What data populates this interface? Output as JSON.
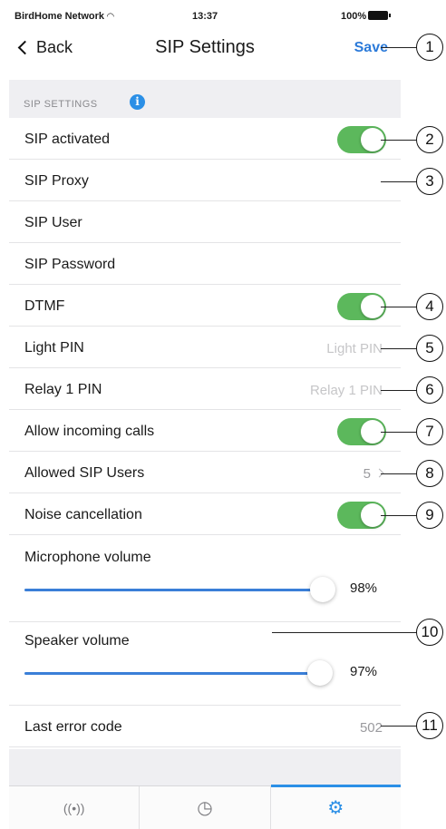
{
  "status_bar": {
    "carrier": "BirdHome Network",
    "time": "13:37",
    "battery": "100%"
  },
  "nav": {
    "back_label": "Back",
    "title": "SIP Settings",
    "save_label": "Save"
  },
  "section": {
    "title": "SIP SETTINGS",
    "info_glyph": "i"
  },
  "rows": [
    {
      "label": "SIP activated",
      "kind": "toggle",
      "on": true
    },
    {
      "label": "SIP Proxy",
      "kind": "text",
      "value": ""
    },
    {
      "label": "SIP User",
      "kind": "text",
      "value": ""
    },
    {
      "label": "SIP Password",
      "kind": "text",
      "value": ""
    },
    {
      "label": "DTMF",
      "kind": "toggle",
      "on": true
    },
    {
      "label": "Light PIN",
      "kind": "input",
      "placeholder": "Light PIN"
    },
    {
      "label": "Relay 1 PIN",
      "kind": "input",
      "placeholder": "Relay 1 PIN"
    },
    {
      "label": "Allow incoming calls",
      "kind": "toggle",
      "on": true
    },
    {
      "label": "Allowed SIP Users",
      "kind": "disclosure",
      "value": "5"
    },
    {
      "label": "Noise cancellation",
      "kind": "toggle",
      "on": true
    }
  ],
  "microphone": {
    "label": "Microphone volume",
    "value_text": "98%",
    "level": 0.98
  },
  "speaker": {
    "label": "Speaker volume",
    "value_text": "97%",
    "level": 0.97
  },
  "last_error": {
    "label": "Last error code",
    "value": "502"
  },
  "tabs": [
    {
      "icon": "broadcast-icon",
      "glyph": "((•))",
      "active": false
    },
    {
      "icon": "gauge-icon",
      "glyph": "◷",
      "active": false
    },
    {
      "icon": "gear-icon",
      "glyph": "⚙",
      "active": true
    }
  ],
  "callouts": [
    "1",
    "2",
    "3",
    "4",
    "5",
    "6",
    "7",
    "8",
    "9",
    "10",
    "11"
  ],
  "colors": {
    "accent": "#2b7ad9",
    "toggle_on": "#5cb85c",
    "slider": "#3a7fd8",
    "section_bg": "#efeff2"
  }
}
